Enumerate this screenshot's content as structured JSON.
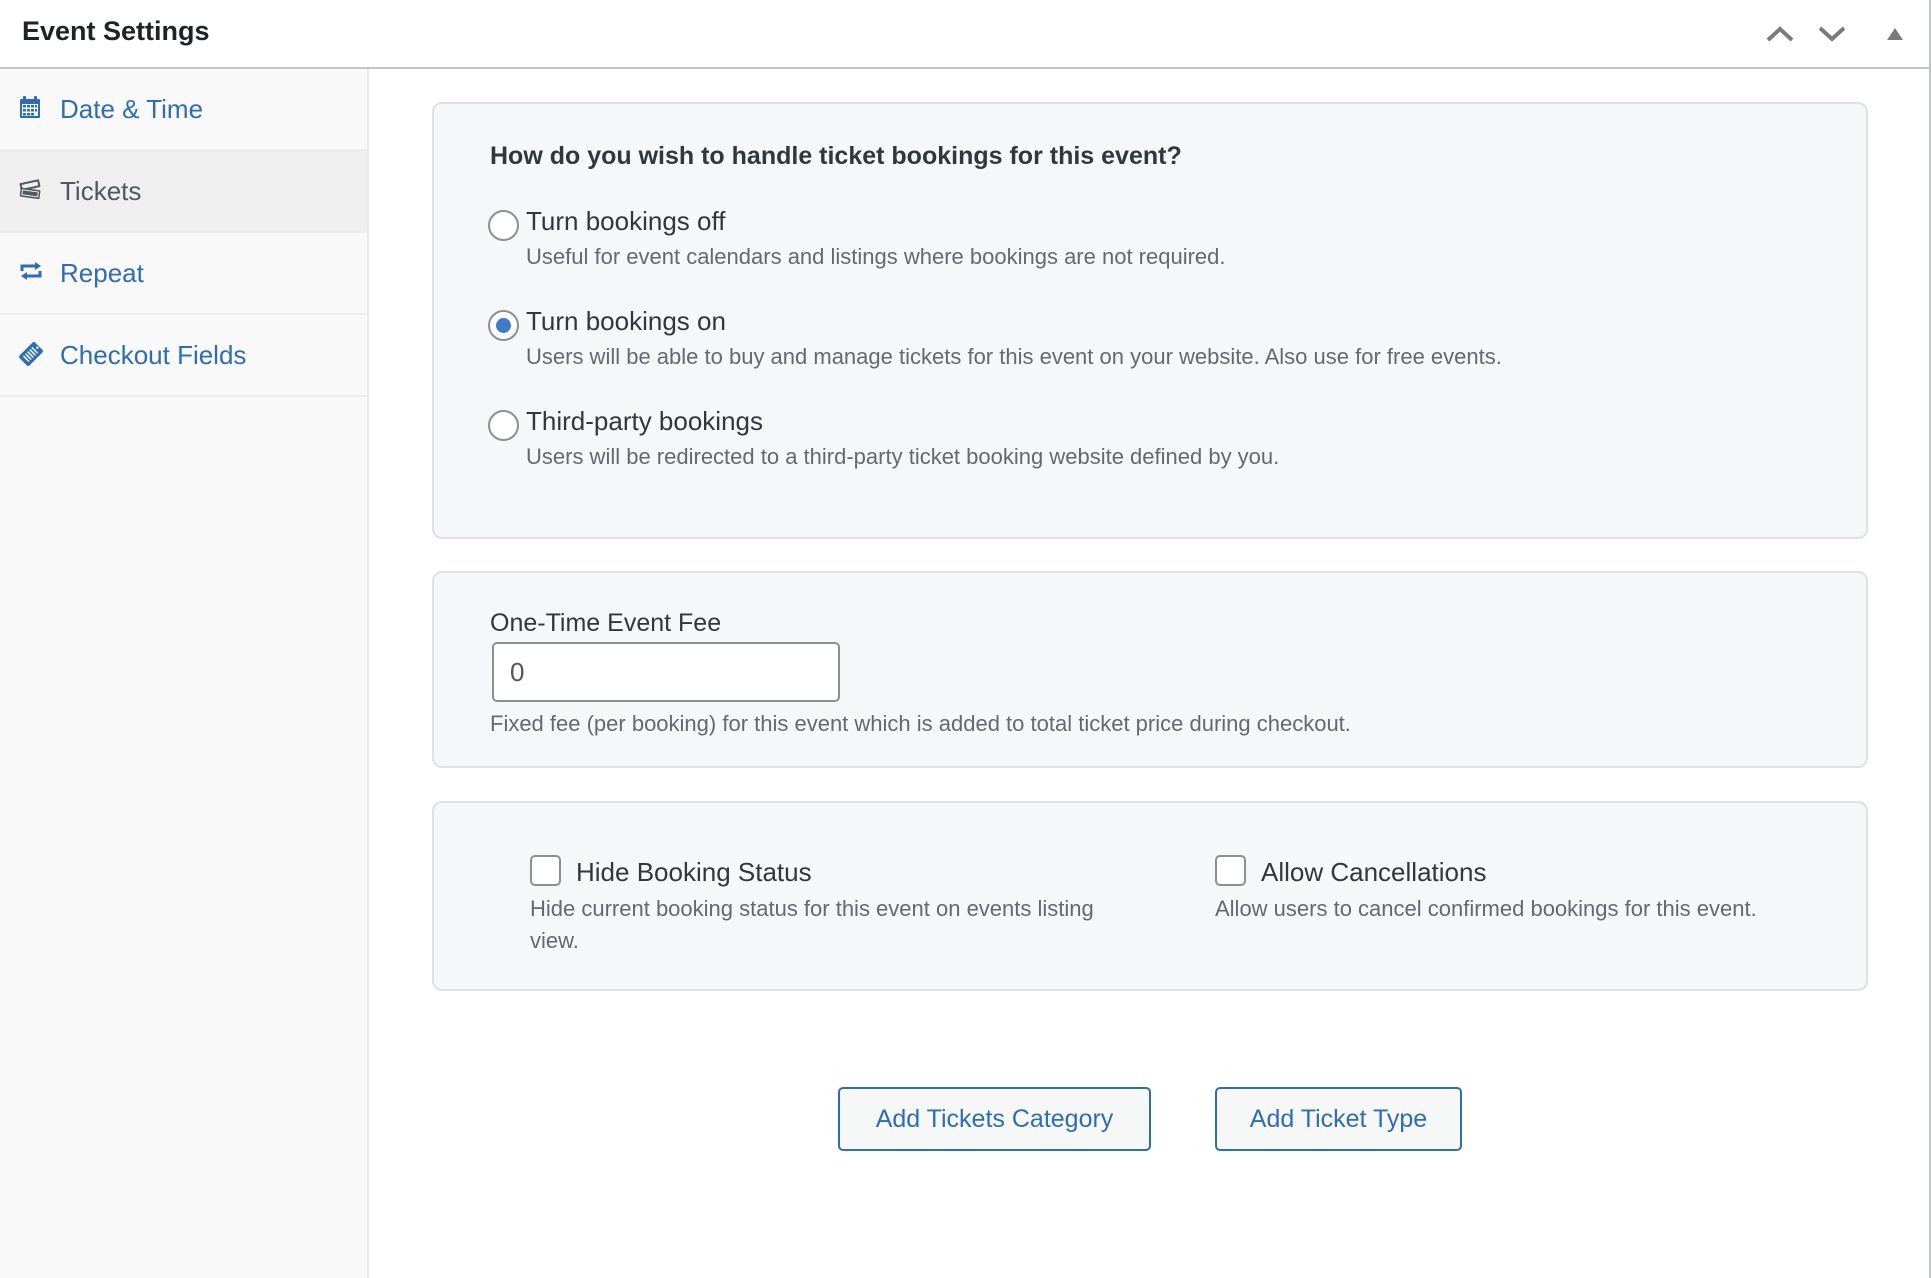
{
  "header": {
    "title": "Event Settings",
    "controls": [
      {
        "name": "move-up",
        "icon": "chevron-up-icon"
      },
      {
        "name": "move-down",
        "icon": "chevron-down-icon"
      },
      {
        "name": "toggle-panel",
        "icon": "triangle-up-icon"
      }
    ]
  },
  "sidebar": {
    "active": "Tickets",
    "items": [
      {
        "label": "Date & Time",
        "icon": "calendar-icon"
      },
      {
        "label": "Tickets",
        "icon": "tickets-icon"
      },
      {
        "label": "Repeat",
        "icon": "repeat-icon"
      },
      {
        "label": "Checkout Fields",
        "icon": "clipboard-tag-icon"
      }
    ]
  },
  "bookings": {
    "question": "How do you wish to handle ticket bookings for this event?",
    "selected": "Turn bookings on",
    "options": [
      {
        "label": "Turn bookings off",
        "description": "Useful for event calendars and listings where bookings are not required.",
        "checked": false
      },
      {
        "label": "Turn bookings on",
        "description": "Users will be able to buy and manage tickets for this event on your website. Also use for free events.",
        "checked": true
      },
      {
        "label": "Third-party bookings",
        "description": "Users will be redirected to a third-party ticket booking website defined by you.",
        "checked": false
      }
    ]
  },
  "fee": {
    "label": "One-Time Event Fee",
    "value": "0",
    "description": "Fixed fee (per booking) for this event which is added to total ticket price during checkout."
  },
  "options": [
    {
      "label": "Hide Booking Status",
      "description": "Hide current booking status for this event on events listing view.",
      "checked": false
    },
    {
      "label": "Allow Cancellations",
      "description": "Allow users to cancel confirmed bookings for this event.",
      "checked": false
    }
  ],
  "actions": {
    "add_category": "Add Tickets Category",
    "add_type": "Add Ticket Type"
  },
  "colors": {
    "accent": "#2e6db4",
    "radio_selected": "#3f7bc8",
    "active_sidebar_bg": "#efefef",
    "panel_bg": "#f6f7f9"
  }
}
